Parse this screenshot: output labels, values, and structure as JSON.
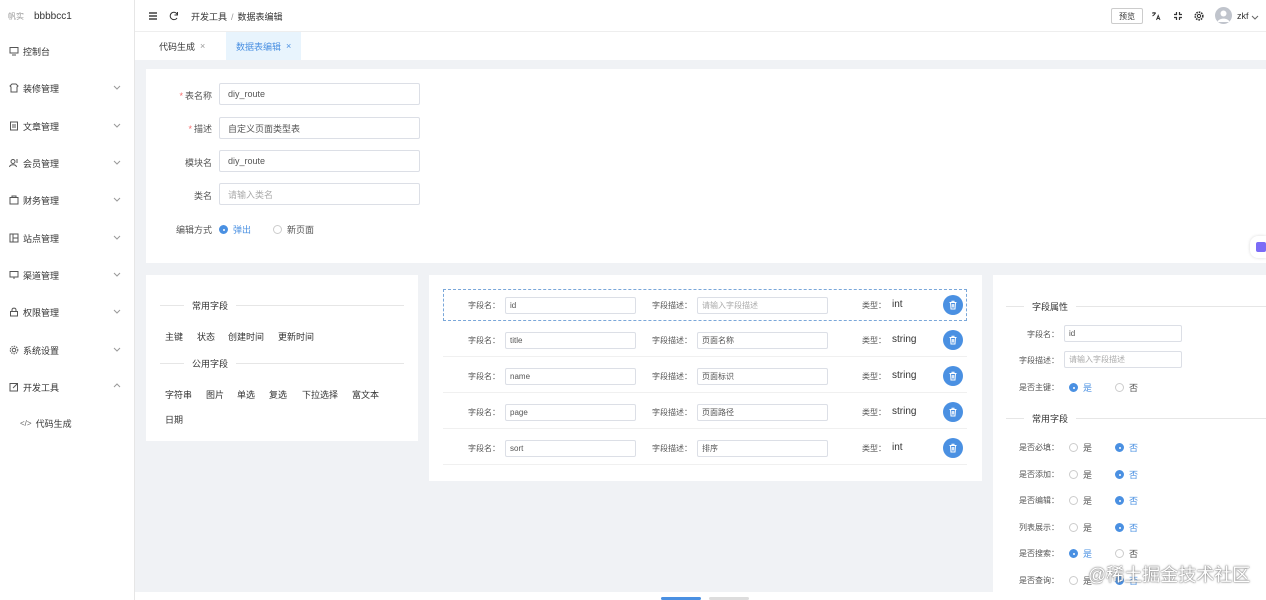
{
  "sidebar": {
    "logo": "帆实",
    "brand": "bbbbcc1",
    "items": [
      {
        "label": "控制台",
        "icon": "monitor-icon"
      },
      {
        "label": "装修管理",
        "icon": "shirt-icon"
      },
      {
        "label": "文章管理",
        "icon": "document-icon"
      },
      {
        "label": "会员管理",
        "icon": "users-icon"
      },
      {
        "label": "财务管理",
        "icon": "wallet-icon"
      },
      {
        "label": "站点管理",
        "icon": "site-icon"
      },
      {
        "label": "渠道管理",
        "icon": "channel-icon"
      },
      {
        "label": "权限管理",
        "icon": "lock-icon"
      },
      {
        "label": "系统设置",
        "icon": "gear-icon"
      },
      {
        "label": "开发工具",
        "icon": "edit-icon"
      }
    ],
    "sub_items": [
      {
        "label": "代码生成",
        "icon_text": "</>"
      }
    ]
  },
  "topbar": {
    "crumbs": [
      "开发工具",
      "数据表编辑"
    ],
    "preview": "预览",
    "user": "zkf"
  },
  "tabs": [
    {
      "label": "代码生成",
      "close": "×"
    },
    {
      "label": "数据表编辑",
      "close": "×"
    }
  ],
  "form": {
    "table_name": {
      "label": "表名称",
      "value": "diy_route"
    },
    "desc": {
      "label": "描述",
      "value": "自定义页面类型表"
    },
    "module": {
      "label": "模块名",
      "value": "diy_route"
    },
    "class": {
      "label": "类名",
      "placeholder": "请输入类名"
    },
    "edit_mode": {
      "label": "编辑方式",
      "options": [
        "弹出",
        "新页面"
      ],
      "selected": "弹出"
    }
  },
  "left_panel": {
    "common_title": "常用字段",
    "common_fields": [
      "主键",
      "状态",
      "创建时间",
      "更新时间"
    ],
    "public_title": "公用字段",
    "public_fields": [
      "字符串",
      "图片",
      "单选",
      "复选",
      "下拉选择",
      "富文本",
      "日期"
    ]
  },
  "field_labels": {
    "name": "字段名：",
    "desc": "字段描述：",
    "type": "类型："
  },
  "fields": [
    {
      "name": "id",
      "desc": "",
      "desc_placeholder": "请输入字段描述",
      "type": "int"
    },
    {
      "name": "title",
      "desc": "页面名称",
      "type": "string"
    },
    {
      "name": "name",
      "desc": "页面标识",
      "type": "string"
    },
    {
      "name": "page",
      "desc": "页面路径",
      "type": "string"
    },
    {
      "name": "sort",
      "desc": "排序",
      "type": "int"
    }
  ],
  "props": {
    "title": "字段属性",
    "name_label": "字段名：",
    "name_value": "id",
    "desc_label": "字段描述：",
    "desc_placeholder": "请输入字段描述",
    "pk_label": "是否主键：",
    "yes": "是",
    "no": "否",
    "common_title": "常用字段",
    "rows": [
      {
        "label": "是否必填：",
        "selected": "no"
      },
      {
        "label": "是否添加：",
        "selected": "no"
      },
      {
        "label": "是否编辑：",
        "selected": "no"
      },
      {
        "label": "列表展示：",
        "selected": "no"
      },
      {
        "label": "是否搜索：",
        "selected": "yes"
      },
      {
        "label": "是否查询：",
        "selected": "no"
      }
    ]
  },
  "watermark": "@稀土掘金技术社区"
}
